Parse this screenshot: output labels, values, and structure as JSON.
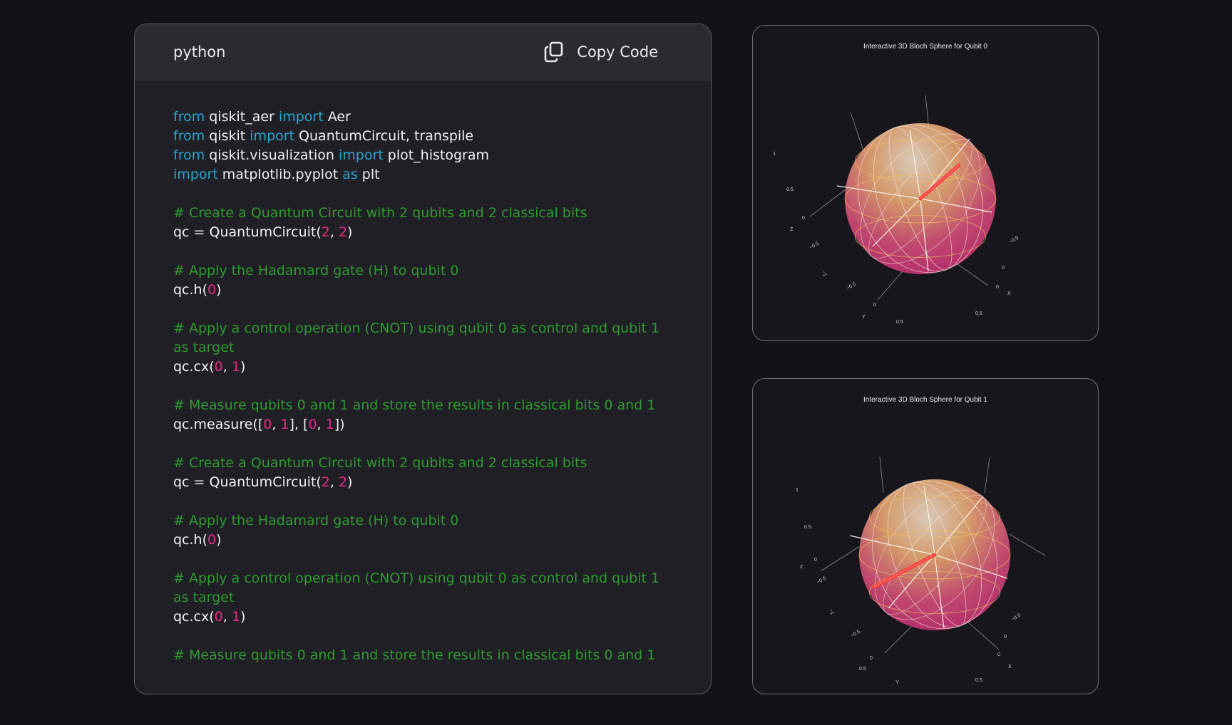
{
  "code_panel": {
    "language": "python",
    "copy_label": "Copy Code",
    "lines": [
      [
        {
          "t": "from",
          "c": "kw"
        },
        {
          "t": " qiskit_aer "
        },
        {
          "t": "import",
          "c": "kw"
        },
        {
          "t": " Aer"
        }
      ],
      [
        {
          "t": "from",
          "c": "kw"
        },
        {
          "t": " qiskit "
        },
        {
          "t": "import",
          "c": "kw"
        },
        {
          "t": " QuantumCircuit, transpile"
        }
      ],
      [
        {
          "t": "from",
          "c": "kw"
        },
        {
          "t": " qiskit.visualization "
        },
        {
          "t": "import",
          "c": "kw"
        },
        {
          "t": " plot_histogram"
        }
      ],
      [
        {
          "t": "import",
          "c": "kw"
        },
        {
          "t": " matplotlib.pyplot "
        },
        {
          "t": "as",
          "c": "kw"
        },
        {
          "t": " plt"
        }
      ],
      [],
      [
        {
          "t": "# Create a Quantum Circuit with 2 qubits and 2 classical bits",
          "c": "cm"
        }
      ],
      [
        {
          "t": "qc = QuantumCircuit("
        },
        {
          "t": "2",
          "c": "num"
        },
        {
          "t": ", "
        },
        {
          "t": "2",
          "c": "num"
        },
        {
          "t": ")"
        }
      ],
      [],
      [
        {
          "t": "# Apply the Hadamard gate (H) to qubit 0",
          "c": "cm"
        }
      ],
      [
        {
          "t": "qc.h("
        },
        {
          "t": "0",
          "c": "num"
        },
        {
          "t": ")"
        }
      ],
      [],
      [
        {
          "t": "# Apply a control operation (CNOT) using qubit 0 as control and qubit 1 as target",
          "c": "cm"
        }
      ],
      [
        {
          "t": "qc.cx("
        },
        {
          "t": "0",
          "c": "num"
        },
        {
          "t": ", "
        },
        {
          "t": "1",
          "c": "num"
        },
        {
          "t": ")"
        }
      ],
      [],
      [
        {
          "t": "# Measure qubits 0 and 1 and store the results in classical bits 0 and 1",
          "c": "cm"
        }
      ],
      [
        {
          "t": "qc.measure(["
        },
        {
          "t": "0",
          "c": "num"
        },
        {
          "t": ", "
        },
        {
          "t": "1",
          "c": "num"
        },
        {
          "t": "], ["
        },
        {
          "t": "0",
          "c": "num"
        },
        {
          "t": ", "
        },
        {
          "t": "1",
          "c": "num"
        },
        {
          "t": "])"
        }
      ],
      [],
      [
        {
          "t": "# Create a Quantum Circuit with 2 qubits and 2 classical bits",
          "c": "cm"
        }
      ],
      [
        {
          "t": "qc = QuantumCircuit("
        },
        {
          "t": "2",
          "c": "num"
        },
        {
          "t": ", "
        },
        {
          "t": "2",
          "c": "num"
        },
        {
          "t": ")"
        }
      ],
      [],
      [
        {
          "t": "# Apply the Hadamard gate (H) to qubit 0",
          "c": "cm"
        }
      ],
      [
        {
          "t": "qc.h("
        },
        {
          "t": "0",
          "c": "num"
        },
        {
          "t": ")"
        }
      ],
      [],
      [
        {
          "t": "# Apply a control operation (CNOT) using qubit 0 as control and qubit 1 as target",
          "c": "cm"
        }
      ],
      [
        {
          "t": "qc.cx("
        },
        {
          "t": "0",
          "c": "num"
        },
        {
          "t": ", "
        },
        {
          "t": "1",
          "c": "num"
        },
        {
          "t": ")"
        }
      ],
      [],
      [
        {
          "t": "# Measure qubits 0 and 1 and store the results in classical bits 0 and 1",
          "c": "cm"
        }
      ]
    ]
  },
  "bloch_spheres": [
    {
      "title": "Interactive 3D Bloch Sphere for Qubit 0",
      "tick_labels": [
        "1",
        "0.5",
        "0",
        "Z",
        "−0.5",
        "−1",
        "−0.5",
        "0",
        "0.5",
        "Y",
        "0",
        "0.5",
        "X",
        "0",
        "−0.5",
        "−1"
      ]
    },
    {
      "title": "Interactive 3D Bloch Sphere for Qubit 1",
      "tick_labels": [
        "1",
        "0.5",
        "0",
        "Z",
        "−0.5",
        "−1",
        "−0.5",
        "0",
        "0.5",
        "Y",
        "0",
        "0.5",
        "X",
        "0",
        "−0.5",
        "−1"
      ]
    }
  ],
  "colors": {
    "keyword": "#2ca6cf",
    "comment": "#2f9b2f",
    "number": "#e52b86",
    "state_vector": "#ff3a3a"
  },
  "icons": {
    "copy": "copy-icon"
  }
}
